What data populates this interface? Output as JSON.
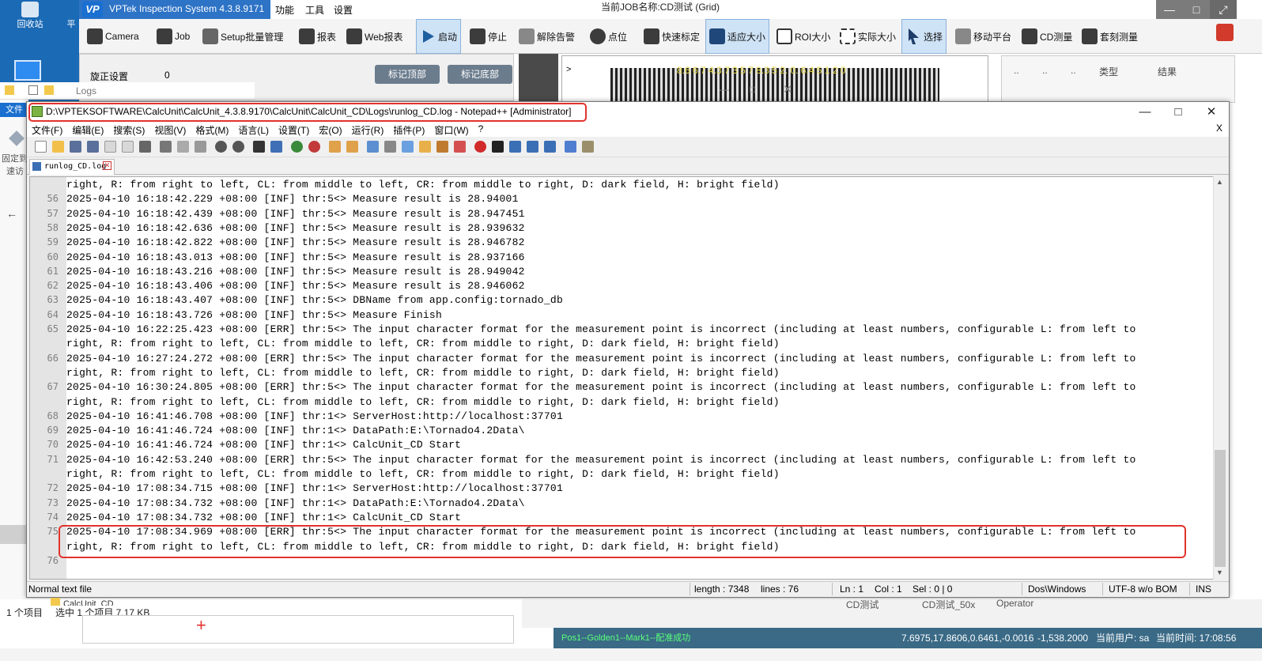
{
  "desktop": {
    "icons": [
      {
        "label": "回收站"
      },
      {
        "label": "平"
      }
    ]
  },
  "vptek": {
    "app_title": "VPTek Inspection System 4.3.8.9171",
    "logo_text": "VP",
    "menus": [
      "功能",
      "工具",
      "设置"
    ],
    "job_label": "当前JOB名称:CD测试 (Grid)",
    "toolbar": [
      {
        "label": "Camera"
      },
      {
        "label": "Job"
      },
      {
        "label": "Setup批量管理"
      },
      {
        "label": "报表"
      },
      {
        "label": "Web报表"
      },
      {
        "label": "启动"
      },
      {
        "label": "停止"
      },
      {
        "label": "解除告警"
      },
      {
        "label": "点位"
      },
      {
        "label": "快速标定"
      },
      {
        "label": "适应大小"
      },
      {
        "label": "ROI大小"
      },
      {
        "label": "实际大小"
      },
      {
        "label": "选择"
      },
      {
        "label": "移动平台"
      },
      {
        "label": "CD测量"
      },
      {
        "label": "套刻测量"
      }
    ],
    "rotation_label": "旋正设置",
    "rotation_value": "0",
    "mark_top_btn": "标记顶部",
    "mark_bottom_btn": "标记底部",
    "view_arrow": ">",
    "view_coord": "8.6 6.7 4.3.7 3 5 7 8.3 5 2. 0. 6.4 5 1 2 0",
    "right_cols": [
      "..",
      "..",
      "..",
      "类型",
      "结果"
    ],
    "bottom_tabs": [
      "CD测试",
      "CD测试_50x",
      "Operator"
    ],
    "status_green": "Pos1--Golden1--Mark1--配准成功",
    "status_coords": "7.6975,17.8606,0.6461,-0.0016",
    "status_pos": "-1,538.2000",
    "status_user": "当前用户: sa",
    "status_time": "当前时间: 17:08:56"
  },
  "explorer": {
    "title": "Logs",
    "file_tab": "文件",
    "side_items": [
      "固定到",
      "速访"
    ],
    "back_arrow": "←",
    "items_count": "1 个项目",
    "selected_info": "选中 1 个项目  7.17 KB",
    "folder_partial": "CalcUnit_CD"
  },
  "notepad": {
    "title": "D:\\VPTEKSOFTWARE\\CalcUnit\\CalcUnit_4.3.8.9170\\CalcUnit\\CalcUnit_CD\\Logs\\runlog_CD.log - Notepad++ [Administrator]",
    "menu": [
      "文件(F)",
      "编辑(E)",
      "搜索(S)",
      "视图(V)",
      "格式(M)",
      "语言(L)",
      "设置(T)",
      "宏(O)",
      "运行(R)",
      "插件(P)",
      "窗口(W)",
      "?"
    ],
    "close_doc": "X",
    "tab_name": "runlog_CD.log",
    "lines": [
      {
        "n": "",
        "t": "right, R: from right to left, CL: from middle to left, CR: from middle to right, D: dark field, H: bright field)"
      },
      {
        "n": "56",
        "t": "2025-04-10 16:18:42.229 +08:00 [INF] thr:5<> Measure result is 28.94001"
      },
      {
        "n": "57",
        "t": "2025-04-10 16:18:42.439 +08:00 [INF] thr:5<> Measure result is 28.947451"
      },
      {
        "n": "58",
        "t": "2025-04-10 16:18:42.636 +08:00 [INF] thr:5<> Measure result is 28.939632"
      },
      {
        "n": "59",
        "t": "2025-04-10 16:18:42.822 +08:00 [INF] thr:5<> Measure result is 28.946782"
      },
      {
        "n": "60",
        "t": "2025-04-10 16:18:43.013 +08:00 [INF] thr:5<> Measure result is 28.937166"
      },
      {
        "n": "61",
        "t": "2025-04-10 16:18:43.216 +08:00 [INF] thr:5<> Measure result is 28.949042"
      },
      {
        "n": "62",
        "t": "2025-04-10 16:18:43.406 +08:00 [INF] thr:5<> Measure result is 28.946062"
      },
      {
        "n": "63",
        "t": "2025-04-10 16:18:43.407 +08:00 [INF] thr:5<> DBName from app.config:tornado_db"
      },
      {
        "n": "64",
        "t": "2025-04-10 16:18:43.726 +08:00 [INF] thr:5<> Measure Finish"
      },
      {
        "n": "65",
        "t": "2025-04-10 16:22:25.423 +08:00 [ERR] thr:5<> The input character format for the measurement point is incorrect (including at least numbers, configurable L: from left to"
      },
      {
        "n": "",
        "t": "right, R: from right to left, CL: from middle to left, CR: from middle to right, D: dark field, H: bright field)"
      },
      {
        "n": "66",
        "t": "2025-04-10 16:27:24.272 +08:00 [ERR] thr:5<> The input character format for the measurement point is incorrect (including at least numbers, configurable L: from left to"
      },
      {
        "n": "",
        "t": "right, R: from right to left, CL: from middle to left, CR: from middle to right, D: dark field, H: bright field)"
      },
      {
        "n": "67",
        "t": "2025-04-10 16:30:24.805 +08:00 [ERR] thr:5<> The input character format for the measurement point is incorrect (including at least numbers, configurable L: from left to"
      },
      {
        "n": "",
        "t": "right, R: from right to left, CL: from middle to left, CR: from middle to right, D: dark field, H: bright field)"
      },
      {
        "n": "68",
        "t": "2025-04-10 16:41:46.708 +08:00 [INF] thr:1<> ServerHost:http://localhost:37701"
      },
      {
        "n": "69",
        "t": "2025-04-10 16:41:46.724 +08:00 [INF] thr:1<> DataPath:E:\\Tornado4.2Data\\"
      },
      {
        "n": "70",
        "t": "2025-04-10 16:41:46.724 +08:00 [INF] thr:1<> CalcUnit_CD Start"
      },
      {
        "n": "71",
        "t": "2025-04-10 16:42:53.240 +08:00 [ERR] thr:5<> The input character format for the measurement point is incorrect (including at least numbers, configurable L: from left to"
      },
      {
        "n": "",
        "t": "right, R: from right to left, CL: from middle to left, CR: from middle to right, D: dark field, H: bright field)"
      },
      {
        "n": "72",
        "t": "2025-04-10 17:08:34.715 +08:00 [INF] thr:1<> ServerHost:http://localhost:37701"
      },
      {
        "n": "73",
        "t": "2025-04-10 17:08:34.732 +08:00 [INF] thr:1<> DataPath:E:\\Tornado4.2Data\\"
      },
      {
        "n": "74",
        "t": "2025-04-10 17:08:34.732 +08:00 [INF] thr:1<> CalcUnit_CD Start"
      },
      {
        "n": "75",
        "t": "2025-04-10 17:08:34.969 +08:00 [ERR] thr:5<> The input character format for the measurement point is incorrect (including at least numbers, configurable L: from left to"
      },
      {
        "n": "",
        "t": "right, R: from right to left, CL: from middle to left, CR: from middle to right, D: dark field, H: bright field)"
      },
      {
        "n": "76",
        "t": ""
      }
    ],
    "status": {
      "file_type": "Normal text file",
      "length": "length : 7348",
      "lines": "lines : 76",
      "ln": "Ln : 1",
      "col": "Col : 1",
      "sel": "Sel : 0 | 0",
      "eol": "Dos\\Windows",
      "encoding": "UTF-8 w/o BOM",
      "mode": "INS"
    }
  }
}
